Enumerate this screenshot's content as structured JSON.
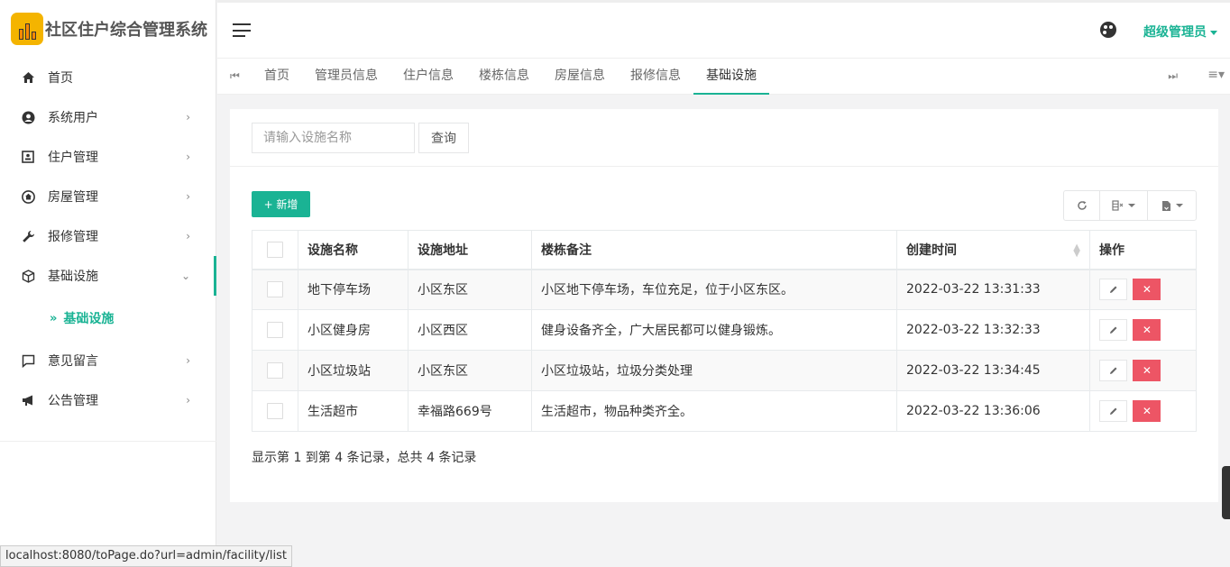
{
  "brand": {
    "title": "社区住户综合管理系统"
  },
  "header": {
    "user": "超级管理员"
  },
  "sidebar": {
    "items": [
      {
        "label": "首页",
        "icon": "home-icon",
        "glyph": "⌂",
        "arrow": ""
      },
      {
        "label": "系统用户",
        "icon": "user-circle-icon",
        "glyph": "●",
        "arrow": "›"
      },
      {
        "label": "住户管理",
        "icon": "contact-card-icon",
        "glyph": "▣",
        "arrow": "›"
      },
      {
        "label": "房屋管理",
        "icon": "house-icon",
        "glyph": "⌂",
        "arrow": "›"
      },
      {
        "label": "报修管理",
        "icon": "wrench-icon",
        "glyph": "🔧",
        "arrow": "›"
      },
      {
        "label": "基础设施",
        "icon": "cube-icon",
        "glyph": "⬡",
        "arrow": "⌄"
      },
      {
        "label": "意见留言",
        "icon": "comment-icon",
        "glyph": "▭",
        "arrow": "›"
      },
      {
        "label": "公告管理",
        "icon": "bullhorn-icon",
        "glyph": "◀",
        "arrow": "›"
      }
    ],
    "submenu": {
      "label": "基础设施",
      "chevron": "»"
    }
  },
  "tabs": [
    "首页",
    "管理员信息",
    "住户信息",
    "楼栋信息",
    "房屋信息",
    "报修信息",
    "基础设施"
  ],
  "search": {
    "placeholder": "请输入设施名称",
    "button": "查询"
  },
  "toolbar": {
    "add": "+ 新增"
  },
  "table": {
    "headers": [
      "设施名称",
      "设施地址",
      "楼栋备注",
      "创建时间",
      "操作"
    ],
    "rows": [
      {
        "name": "地下停车场",
        "addr": "小区东区",
        "note": "小区地下停车场，车位充足，位于小区东区。",
        "time": "2022-03-22 13:31:33"
      },
      {
        "name": "小区健身房",
        "addr": "小区西区",
        "note": "健身设备齐全，广大居民都可以健身锻炼。",
        "time": "2022-03-22 13:32:33"
      },
      {
        "name": "小区垃圾站",
        "addr": "小区东区",
        "note": "小区垃圾站，垃圾分类处理",
        "time": "2022-03-22 13:34:45"
      },
      {
        "name": "生活超市",
        "addr": "幸福路669号",
        "note": "生活超市，物品种类齐全。",
        "time": "2022-03-22 13:36:06"
      }
    ]
  },
  "pager": {
    "info": "显示第 1 到第 4 条记录，总共 4 条记录"
  },
  "statusbar": {
    "url": "localhost:8080/toPage.do?url=admin/facility/list"
  },
  "colors": {
    "accent": "#1ab394",
    "danger": "#ed5565"
  }
}
